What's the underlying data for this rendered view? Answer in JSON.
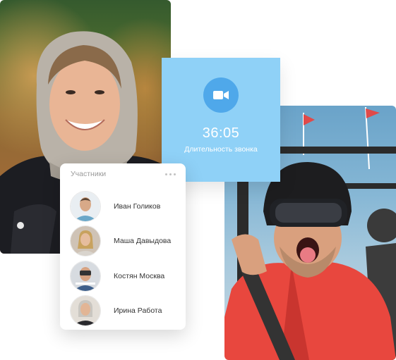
{
  "call_card": {
    "duration": "36:05",
    "label": "Длительность звонка",
    "icon": "video-camera-icon",
    "background_color": "#8fd1f7",
    "icon_circle_color": "#4fa8ea"
  },
  "participants": {
    "title": "Участники",
    "menu_icon": "more-dots-icon",
    "items": [
      {
        "name": "Иван Голиков"
      },
      {
        "name": "Маша Давыдова"
      },
      {
        "name": "Костян Москва"
      },
      {
        "name": "Ирина Работа"
      }
    ]
  }
}
